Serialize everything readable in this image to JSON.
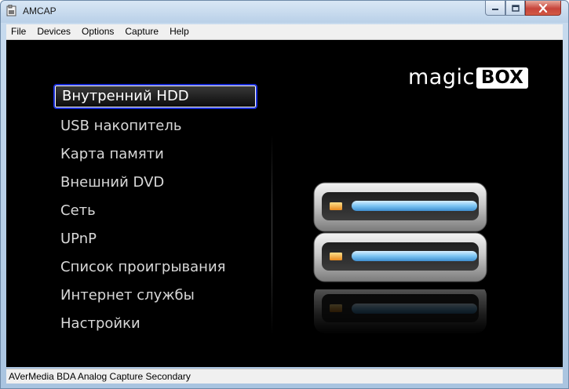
{
  "window": {
    "title": "AMCAP",
    "status": "AVerMedia BDA Analog Capture Secondary"
  },
  "menubar": {
    "items": [
      "File",
      "Devices",
      "Options",
      "Capture",
      "Help"
    ]
  },
  "video": {
    "logo": {
      "magic": "magic",
      "box": "BOX"
    },
    "menu": [
      "Внутренний HDD",
      "USB накопитель",
      "Карта памяти",
      "Внешний DVD",
      "Сеть",
      "UPnP",
      "Список проигрывания",
      "Интернет службы",
      "Настройки"
    ],
    "selected_index": 0
  }
}
